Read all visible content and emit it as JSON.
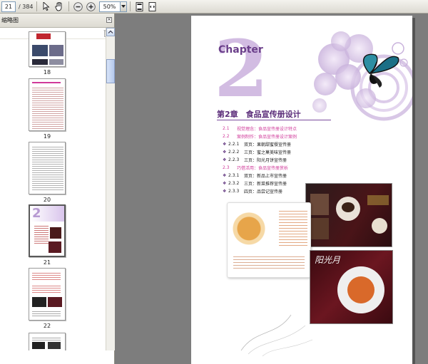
{
  "toolbar": {
    "current_page": "21",
    "total_pages": "/ 384",
    "zoom": "50%",
    "icons": [
      "select-arrow-icon",
      "hand-tool-icon",
      "zoom-out-icon",
      "zoom-in-icon",
      "fit-page-icon",
      "fit-width-icon"
    ]
  },
  "panel": {
    "title": "缩略图",
    "thumbnails": [
      {
        "label": "18"
      },
      {
        "label": "19"
      },
      {
        "label": "20"
      },
      {
        "label": "21",
        "selected": true
      },
      {
        "label": "22"
      }
    ]
  },
  "document": {
    "chapter_word": "Chapter",
    "chapter_number": "2",
    "chapter_title": "第2章　食品宣传册设计",
    "toc": [
      {
        "num": "2.1",
        "text": "视觉理念：食品宣传册设计特点",
        "level": "section"
      },
      {
        "num": "2.2",
        "text": "案例制作：食品宣传册设计案例",
        "level": "section"
      },
      {
        "num": "2.2.1",
        "text": "双页：果朝甜蜜餐宣传册",
        "level": "sub"
      },
      {
        "num": "2.2.2",
        "text": "三页：蜜之菓美味宣传册",
        "level": "sub"
      },
      {
        "num": "2.2.3",
        "text": "三页：阳光月饼宣传册",
        "level": "sub"
      },
      {
        "num": "2.3",
        "text": "巧借活用：食品宣传册赏析",
        "level": "section"
      },
      {
        "num": "2.3.1",
        "text": "双页：新品上市宣传册",
        "level": "sub"
      },
      {
        "num": "2.3.2",
        "text": "三页：新菜推荐宣传册",
        "level": "sub"
      },
      {
        "num": "2.3.3",
        "text": "四页：品尝记宣传册",
        "level": "sub"
      }
    ],
    "colors": {
      "accent_purple": "#6b3f8a",
      "section_pink": "#d03a9a",
      "page_bg": "#ffffff",
      "viewer_bg": "#7d7d7d"
    }
  }
}
